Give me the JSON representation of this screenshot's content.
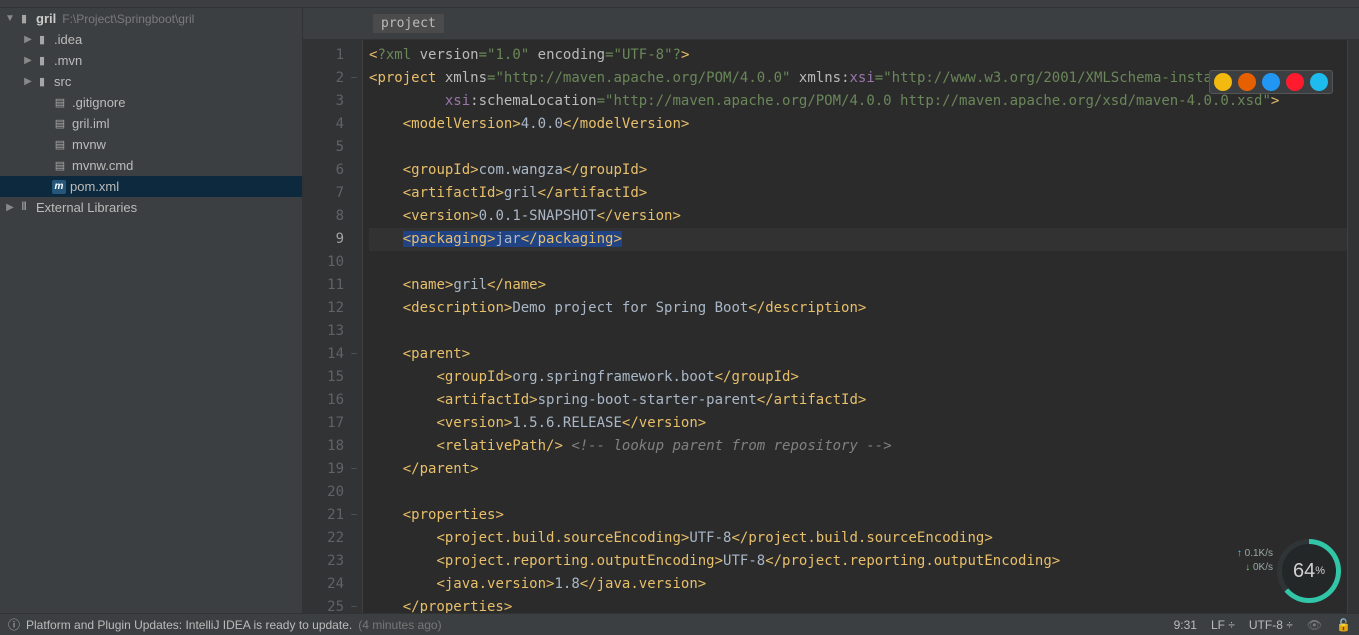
{
  "project": {
    "name": "gril",
    "path": "F:\\Project\\Springboot\\gril",
    "tree": [
      {
        "depth": 0,
        "chev": "▼",
        "icon": "folder",
        "label": "gril",
        "extra": "F:\\Project\\Springboot\\gril"
      },
      {
        "depth": 1,
        "chev": "▶",
        "icon": "folder",
        "label": ".idea"
      },
      {
        "depth": 1,
        "chev": "▶",
        "icon": "folder",
        "label": ".mvn"
      },
      {
        "depth": 1,
        "chev": "▶",
        "icon": "folder",
        "label": "src"
      },
      {
        "depth": 2,
        "chev": "",
        "icon": "file",
        "label": ".gitignore"
      },
      {
        "depth": 2,
        "chev": "",
        "icon": "file",
        "label": "gril.iml"
      },
      {
        "depth": 2,
        "chev": "",
        "icon": "file",
        "label": "mvnw"
      },
      {
        "depth": 2,
        "chev": "",
        "icon": "file",
        "label": "mvnw.cmd"
      },
      {
        "depth": 2,
        "chev": "",
        "icon": "m",
        "label": "pom.xml",
        "selected": true
      },
      {
        "depth": 0,
        "chev": "▶",
        "icon": "libs",
        "label": "External Libraries"
      }
    ]
  },
  "breadcrumb": "project",
  "code": {
    "lines": 25,
    "current_line": 9,
    "hl_lines": [
      9
    ],
    "tokens": [
      [
        [
          "br",
          "<"
        ],
        [
          "p",
          "?xml "
        ],
        [
          "a",
          "version"
        ],
        [
          "p",
          "="
        ],
        [
          "v",
          "\"1.0\""
        ],
        [
          "p",
          " "
        ],
        [
          "a",
          "encoding"
        ],
        [
          "p",
          "="
        ],
        [
          "v",
          "\"UTF-8\""
        ],
        [
          "p",
          "?"
        ],
        [
          "br",
          ">"
        ]
      ],
      [
        [
          "br",
          "<"
        ],
        [
          "t",
          "project "
        ],
        [
          "a",
          "xmlns"
        ],
        [
          "p",
          "="
        ],
        [
          "v",
          "\"http://maven.apache.org/POM/4.0.0\""
        ],
        [
          "tx",
          " "
        ],
        [
          "a",
          "xmlns:"
        ],
        [
          "ns",
          "xsi"
        ],
        [
          "p",
          "="
        ],
        [
          "v",
          "\"http://www.w3.org/2001/XMLSchema-instance\""
        ]
      ],
      [
        [
          "tx",
          "         "
        ],
        [
          "ns",
          "xsi"
        ],
        [
          "a",
          ":schemaLocation"
        ],
        [
          "p",
          "="
        ],
        [
          "v",
          "\"http://maven.apache.org/POM/4.0.0 http://maven.apache.org/xsd/maven-4.0.0.xsd\""
        ],
        [
          "br",
          ">"
        ]
      ],
      [
        [
          "tx",
          "    "
        ],
        [
          "br",
          "<"
        ],
        [
          "t",
          "modelVersion"
        ],
        [
          "br",
          ">"
        ],
        [
          "tx",
          "4.0.0"
        ],
        [
          "br",
          "</"
        ],
        [
          "t",
          "modelVersion"
        ],
        [
          "br",
          ">"
        ]
      ],
      [
        [
          "tx",
          " "
        ]
      ],
      [
        [
          "tx",
          "    "
        ],
        [
          "br",
          "<"
        ],
        [
          "t",
          "groupId"
        ],
        [
          "br",
          ">"
        ],
        [
          "tx",
          "com.wangza"
        ],
        [
          "br",
          "</"
        ],
        [
          "t",
          "groupId"
        ],
        [
          "br",
          ">"
        ]
      ],
      [
        [
          "tx",
          "    "
        ],
        [
          "br",
          "<"
        ],
        [
          "t",
          "artifactId"
        ],
        [
          "br",
          ">"
        ],
        [
          "tx",
          "gril"
        ],
        [
          "br",
          "</"
        ],
        [
          "t",
          "artifactId"
        ],
        [
          "br",
          ">"
        ]
      ],
      [
        [
          "tx",
          "    "
        ],
        [
          "br",
          "<"
        ],
        [
          "t",
          "version"
        ],
        [
          "br",
          ">"
        ],
        [
          "tx",
          "0.0.1-SNAPSHOT"
        ],
        [
          "br",
          "</"
        ],
        [
          "t",
          "version"
        ],
        [
          "br",
          ">"
        ]
      ],
      [
        [
          "tx",
          "    "
        ],
        [
          "br",
          "<"
        ],
        [
          "t",
          "packaging"
        ],
        [
          "br",
          ">"
        ],
        [
          "tx",
          "jar"
        ],
        [
          "br",
          "</"
        ],
        [
          "t",
          "packaging"
        ],
        [
          "br",
          ">"
        ]
      ],
      [
        [
          "tx",
          " "
        ]
      ],
      [
        [
          "tx",
          "    "
        ],
        [
          "br",
          "<"
        ],
        [
          "t",
          "name"
        ],
        [
          "br",
          ">"
        ],
        [
          "tx",
          "gril"
        ],
        [
          "br",
          "</"
        ],
        [
          "t",
          "name"
        ],
        [
          "br",
          ">"
        ]
      ],
      [
        [
          "tx",
          "    "
        ],
        [
          "br",
          "<"
        ],
        [
          "t",
          "description"
        ],
        [
          "br",
          ">"
        ],
        [
          "tx",
          "Demo project for Spring Boot"
        ],
        [
          "br",
          "</"
        ],
        [
          "t",
          "description"
        ],
        [
          "br",
          ">"
        ]
      ],
      [
        [
          "tx",
          " "
        ]
      ],
      [
        [
          "tx",
          "    "
        ],
        [
          "br",
          "<"
        ],
        [
          "t",
          "parent"
        ],
        [
          "br",
          ">"
        ]
      ],
      [
        [
          "tx",
          "        "
        ],
        [
          "br",
          "<"
        ],
        [
          "t",
          "groupId"
        ],
        [
          "br",
          ">"
        ],
        [
          "tx",
          "org.springframework.boot"
        ],
        [
          "br",
          "</"
        ],
        [
          "t",
          "groupId"
        ],
        [
          "br",
          ">"
        ]
      ],
      [
        [
          "tx",
          "        "
        ],
        [
          "br",
          "<"
        ],
        [
          "t",
          "artifactId"
        ],
        [
          "br",
          ">"
        ],
        [
          "tx",
          "spring-boot-starter-parent"
        ],
        [
          "br",
          "</"
        ],
        [
          "t",
          "artifactId"
        ],
        [
          "br",
          ">"
        ]
      ],
      [
        [
          "tx",
          "        "
        ],
        [
          "br",
          "<"
        ],
        [
          "t",
          "version"
        ],
        [
          "br",
          ">"
        ],
        [
          "tx",
          "1.5.6.RELEASE"
        ],
        [
          "br",
          "</"
        ],
        [
          "t",
          "version"
        ],
        [
          "br",
          ">"
        ]
      ],
      [
        [
          "tx",
          "        "
        ],
        [
          "br",
          "<"
        ],
        [
          "t",
          "relativePath/"
        ],
        [
          "br",
          ">"
        ],
        [
          "tx",
          " "
        ],
        [
          "c",
          "<!-- lookup parent from repository -->"
        ]
      ],
      [
        [
          "tx",
          "    "
        ],
        [
          "br",
          "</"
        ],
        [
          "t",
          "parent"
        ],
        [
          "br",
          ">"
        ]
      ],
      [
        [
          "tx",
          " "
        ]
      ],
      [
        [
          "tx",
          "    "
        ],
        [
          "br",
          "<"
        ],
        [
          "t",
          "properties"
        ],
        [
          "br",
          ">"
        ]
      ],
      [
        [
          "tx",
          "        "
        ],
        [
          "br",
          "<"
        ],
        [
          "t",
          "project.build.sourceEncoding"
        ],
        [
          "br",
          ">"
        ],
        [
          "tx",
          "UTF-8"
        ],
        [
          "br",
          "</"
        ],
        [
          "t",
          "project.build.sourceEncoding"
        ],
        [
          "br",
          ">"
        ]
      ],
      [
        [
          "tx",
          "        "
        ],
        [
          "br",
          "<"
        ],
        [
          "t",
          "project.reporting.outputEncoding"
        ],
        [
          "br",
          ">"
        ],
        [
          "tx",
          "UTF-8"
        ],
        [
          "br",
          "</"
        ],
        [
          "t",
          "project.reporting.outputEncoding"
        ],
        [
          "br",
          ">"
        ]
      ],
      [
        [
          "tx",
          "        "
        ],
        [
          "br",
          "<"
        ],
        [
          "t",
          "java.version"
        ],
        [
          "br",
          ">"
        ],
        [
          "tx",
          "1.8"
        ],
        [
          "br",
          "</"
        ],
        [
          "t",
          "java.version"
        ],
        [
          "br",
          ">"
        ]
      ],
      [
        [
          "tx",
          "    "
        ],
        [
          "br",
          "</"
        ],
        [
          "t",
          "properties"
        ],
        [
          "br",
          ">"
        ]
      ]
    ],
    "folds": {
      "2": "–",
      "14": "–",
      "19": "–",
      "21": "–",
      "25": "–"
    }
  },
  "browsers": [
    "chrome",
    "firefox",
    "safari",
    "opera",
    "ie"
  ],
  "browser_colors": {
    "chrome": "#f2b90f",
    "firefox": "#e66000",
    "safari": "#2196f3",
    "opera": "#ff1b2d",
    "ie": "#1ebbee"
  },
  "status": {
    "icon": "ⓘ",
    "msg": "Platform and Plugin Updates: IntelliJ IDEA is ready to update.",
    "age": "(4 minutes ago)",
    "pos": "9:31",
    "le": "LF ÷",
    "enc": "UTF-8 ÷"
  },
  "gauge": {
    "up": "0.1K/s",
    "dn": "0K/s",
    "pct": "64",
    "unit": "%"
  }
}
